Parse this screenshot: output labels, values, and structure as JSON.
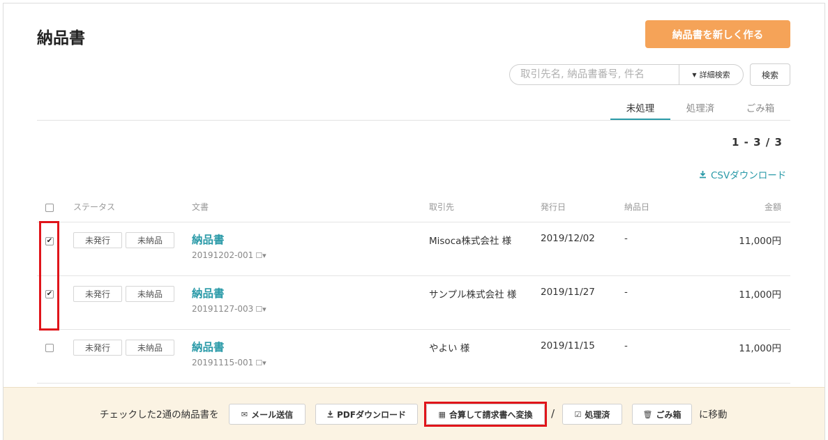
{
  "page": {
    "title": "納品書",
    "new_button": "納品書を新しく作る"
  },
  "search": {
    "placeholder": "取引先名, 納品書番号, 件名",
    "advanced_label": "詳細検索",
    "button_label": "検索"
  },
  "tabs": [
    {
      "label": "未処理",
      "active": true
    },
    {
      "label": "処理済",
      "active": false
    },
    {
      "label": "ごみ箱",
      "active": false
    }
  ],
  "pager": "1 - 3 / 3",
  "csv_label": "CSVダウンロード",
  "columns": {
    "status": "ステータス",
    "doc": "文書",
    "client": "取引先",
    "issued": "発行日",
    "delivered": "納品日",
    "amount": "金額"
  },
  "rows": [
    {
      "checked": true,
      "status1": "未発行",
      "status2": "未納品",
      "title": "納品書",
      "number": "20191202-001",
      "client": "Misoca株式会社 様",
      "issued": "2019/12/02",
      "delivered": "-",
      "amount": "11,000円"
    },
    {
      "checked": true,
      "status1": "未発行",
      "status2": "未納品",
      "title": "納品書",
      "number": "20191127-003",
      "client": "サンプル株式会社 様",
      "issued": "2019/11/27",
      "delivered": "-",
      "amount": "11,000円"
    },
    {
      "checked": false,
      "status1": "未発行",
      "status2": "未納品",
      "title": "納品書",
      "number": "20191115-001",
      "client": "やよい 様",
      "issued": "2019/11/15",
      "delivered": "-",
      "amount": "11,000円"
    }
  ],
  "footer": {
    "lead": "チェックした2通の納品書を",
    "mail": "メール送信",
    "pdf": "PDFダウンロード",
    "merge": "合算して請求書へ変換",
    "slash": "/",
    "done": "処理済",
    "trash": "ごみ箱",
    "tail": "に移動"
  },
  "colors": {
    "accent": "#2a9aa8",
    "primary_button": "#f5a358",
    "highlight": "#e0141a",
    "footer_bg": "#fbf3e3"
  }
}
